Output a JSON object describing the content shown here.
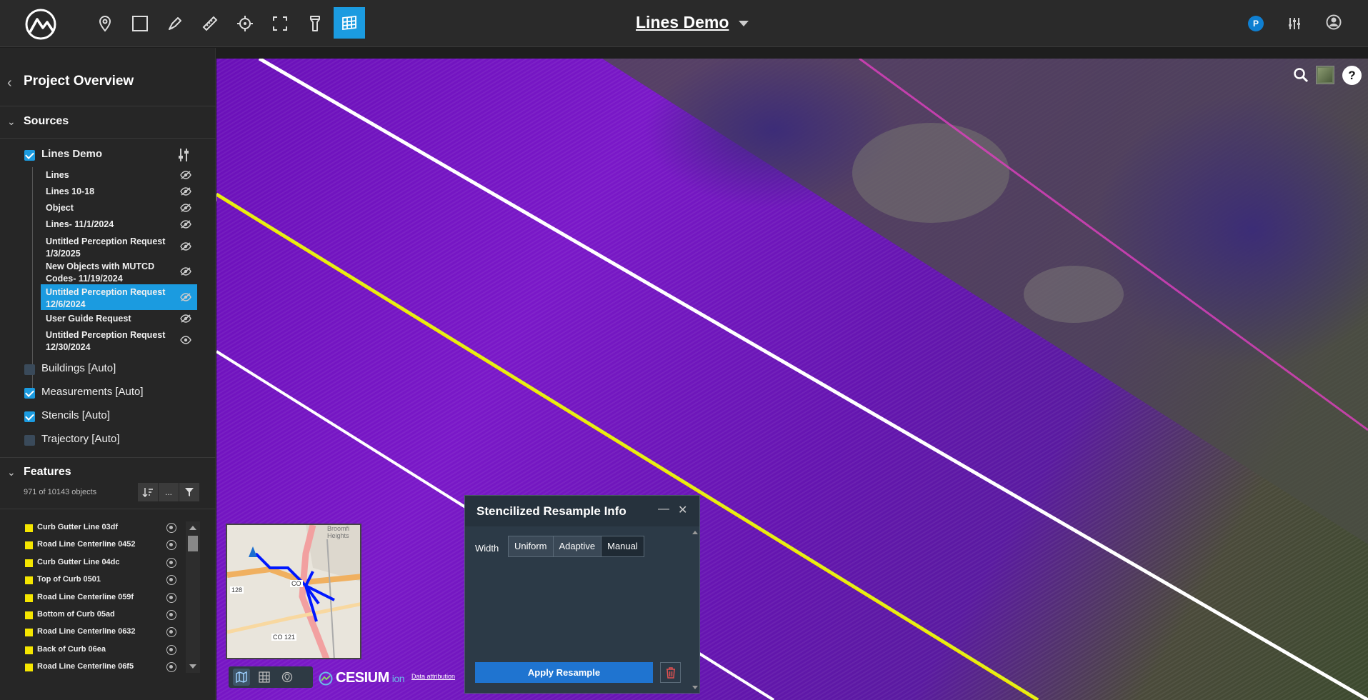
{
  "app": {
    "title": "Lines Demo",
    "user_initial": "P"
  },
  "toolbar": {
    "tools": [
      "pin-tool",
      "rectangle-tool",
      "draw-tool",
      "measure-tool",
      "target-tool",
      "fullscreen-tool",
      "flashlight-tool",
      "grid-tool"
    ],
    "active_tool": "grid-tool"
  },
  "sidebar": {
    "title": "Project Overview",
    "sources_label": "Sources",
    "project": {
      "label": "Lines Demo",
      "checked": true
    },
    "layers": [
      {
        "label": "Lines",
        "visible": false
      },
      {
        "label": "Lines 10-18",
        "visible": false
      },
      {
        "label": "Object",
        "visible": false
      },
      {
        "label": "Lines- 11/1/2024",
        "visible": false
      },
      {
        "label": "Untitled Perception Request 1/3/2025",
        "visible": false
      },
      {
        "label": "New Objects with MUTCD Codes- 11/19/2024",
        "visible": false
      },
      {
        "label": "Untitled Perception Request 12/6/2024",
        "visible": false,
        "selected": true
      },
      {
        "label": "User Guide Request",
        "visible": false
      },
      {
        "label": "Untitled Perception Request 12/30/2024",
        "visible": true
      }
    ],
    "auto_sources": [
      {
        "label": "Buildings [Auto]",
        "checked": false
      },
      {
        "label": "Measurements [Auto]",
        "checked": true
      },
      {
        "label": "Stencils [Auto]",
        "checked": true
      },
      {
        "label": "Trajectory [Auto]",
        "checked": false
      }
    ],
    "features_label": "Features",
    "object_count": "971 of 10143 objects",
    "more_label": "...",
    "features": [
      "Curb Gutter Line 03df",
      "Road Line Centerline 0452",
      "Curb Gutter Line 04dc",
      "Top of Curb 0501",
      "Road Line Centerline 059f",
      "Bottom of Curb 05ad",
      "Road Line Centerline 0632",
      "Back of Curb 06ea",
      "Road Line Centerline 06f5"
    ]
  },
  "map": {
    "minimap_labels": [
      "Broomfi Heights",
      "128",
      "CO",
      "CO 121"
    ],
    "cesium_label": "CESIUM",
    "cesium_ion": "ion",
    "attribution": "Data attribution"
  },
  "dialog": {
    "title": "Stencilized Resample Info",
    "width_label": "Width",
    "options": [
      "Uniform",
      "Adaptive",
      "Manual"
    ],
    "selected_option": "Manual",
    "apply_label": "Apply Resample"
  },
  "colors": {
    "accent": "#1b9be0",
    "pointcloud": "#6a10b8",
    "feature_swatch": "#f5e600",
    "apply_button": "#1f74d0"
  }
}
